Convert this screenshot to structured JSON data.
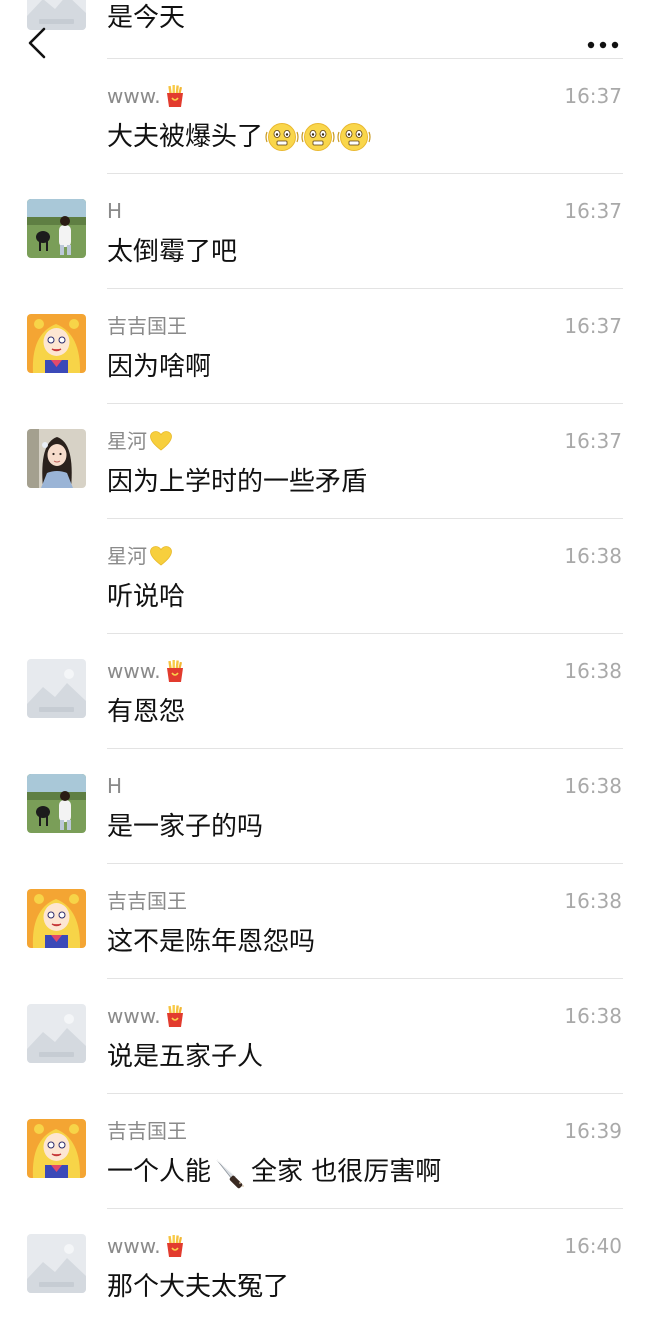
{
  "header": {
    "back_icon": "chevron-left-icon",
    "more_icon": "more-horizontal-icon",
    "top_partial_text": "是今天"
  },
  "colors": {
    "divider": "#e3e3e3",
    "sender_name": "#8a8a8a",
    "timestamp": "#a9a9a9",
    "message_text": "#111111"
  },
  "messages": [
    {
      "sender": "www.",
      "sender_emoji": "fries-emoji",
      "time": "16:37",
      "text": "大夫被爆头了",
      "avatar": "none",
      "trailing_emoji": "shaking-face-emoji x3"
    },
    {
      "sender": "H",
      "time": "16:37",
      "text": "太倒霉了吧",
      "avatar": "grassland-horse-photo"
    },
    {
      "sender": "吉吉国王",
      "time": "16:37",
      "text": "因为啥啊",
      "avatar": "anime-girl-avatar"
    },
    {
      "sender": "星河",
      "sender_emoji": "yellow-heart-emoji",
      "time": "16:37",
      "text": "因为上学时的一些矛盾",
      "avatar": "girl-photo-avatar"
    },
    {
      "sender": "星河",
      "sender_emoji": "yellow-heart-emoji",
      "time": "16:38",
      "text": "听说哈",
      "avatar": "none"
    },
    {
      "sender": "www.",
      "sender_emoji": "fries-emoji",
      "time": "16:38",
      "text": "有恩怨",
      "avatar": "placeholder-image"
    },
    {
      "sender": "H",
      "time": "16:38",
      "text": "是一家子的吗",
      "avatar": "grassland-horse-photo"
    },
    {
      "sender": "吉吉国王",
      "time": "16:38",
      "text": "这不是陈年恩怨吗",
      "avatar": "anime-girl-avatar"
    },
    {
      "sender": "www.",
      "sender_emoji": "fries-emoji",
      "time": "16:38",
      "text": "说是五家子人",
      "avatar": "placeholder-image"
    },
    {
      "sender": "吉吉国王",
      "time": "16:39",
      "text_before": "一个人能",
      "inline_emoji": "knife-emoji",
      "text_after": "全家 也很厉害啊",
      "avatar": "anime-girl-avatar"
    },
    {
      "sender": "www.",
      "sender_emoji": "fries-emoji",
      "time": "16:40",
      "text": "那个大夫太冤了",
      "avatar": "placeholder-image"
    }
  ]
}
